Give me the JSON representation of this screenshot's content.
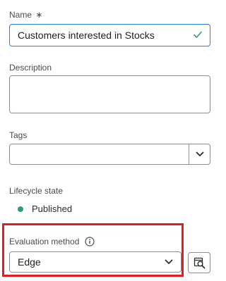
{
  "name": {
    "label": "Name",
    "required_marker": "∗",
    "value": "Customers interested in Stocks",
    "status_icon": "checkmark-icon"
  },
  "description": {
    "label": "Description",
    "value": ""
  },
  "tags": {
    "label": "Tags",
    "value": "",
    "dropdown_icon": "chevron-down-icon"
  },
  "lifecycle": {
    "label": "Lifecycle state",
    "value": "Published",
    "status_color": "#2d9d78"
  },
  "evaluation": {
    "label": "Evaluation method",
    "info_icon": "info-icon",
    "value": "Edge",
    "side_button_icon": "data-preview-icon"
  },
  "colors": {
    "accent_focus": "#2680eb",
    "valid_check": "#2d9d78",
    "highlight": "#e31b23"
  }
}
